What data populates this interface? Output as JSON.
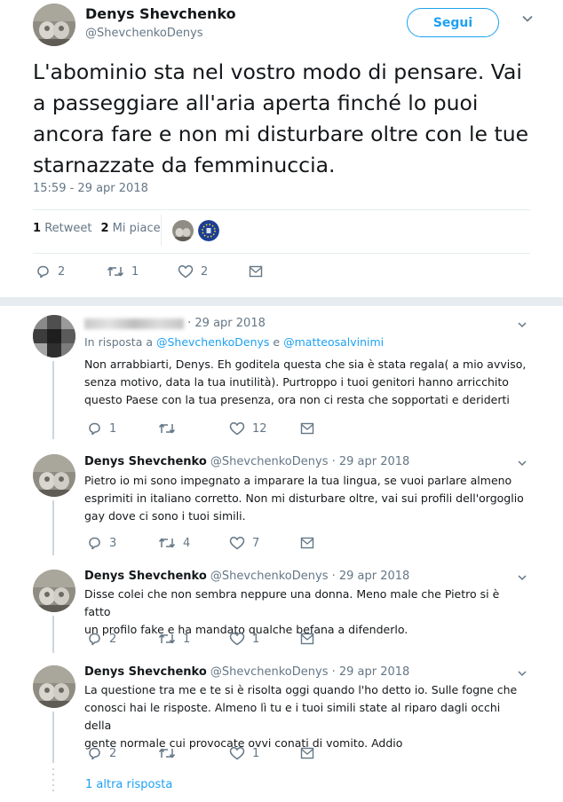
{
  "main_tweet": {
    "author_name": "Denys Shevchenko",
    "author_handle": "@ShevchenkoDenys",
    "follow_label": "Segui",
    "text": "L'abominio sta nel vostro modo di pensare. Vai a passeggiare all'aria aperta finché lo puoi ancora fare e non mi disturbare oltre con le tue starnazzate da femminuccia.",
    "timestamp": "15:59 - 29 apr 2018",
    "retweets_count": "1",
    "retweets_label": "Retweet",
    "likes_count": "2",
    "likes_label": "Mi piace",
    "actions": {
      "replies": "2",
      "retweets": "1",
      "likes": "2"
    }
  },
  "replies": [
    {
      "name": "",
      "meta": "· 29 apr 2018",
      "in_reply_prefix": "In risposta a",
      "in_reply_user1": "@ShevchenkoDenys",
      "in_reply_and": "e",
      "in_reply_user2": "@matteosalvinimi",
      "lines": [
        "Non arrabbiarti, Denys. Eh goditela questa che sia è stata regala( a mio avviso,",
        "senza motivo, data la tua inutilità). Purtroppo i tuoi genitori hanno arricchito",
        "questo Paese con la tua presenza, ora non ci resta che sopportati e deriderti"
      ],
      "actions": {
        "replies": "1",
        "retweets": "",
        "likes": "12"
      }
    },
    {
      "name": "Denys Shevchenko",
      "meta": "@ShevchenkoDenys · 29 apr 2018",
      "lines": [
        "Pietro io mi sono impegnato a imparare la tua lingua, se vuoi parlare almeno",
        "esprimiti in italiano corretto. Non mi disturbare oltre, vai sui profili dell'orgoglio",
        "gay dove ci sono i tuoi simili."
      ],
      "actions": {
        "replies": "3",
        "retweets": "4",
        "likes": "7"
      }
    },
    {
      "name": "Denys Shevchenko",
      "meta": "@ShevchenkoDenys · 29 apr 2018",
      "lines": [
        "Disse colei che non sembra neppure una donna. Meno male che Pietro si è fatto",
        "un profilo fake e ha mandato qualche befana a difenderlo."
      ],
      "actions": {
        "replies": "2",
        "retweets": "1",
        "likes": "1"
      }
    },
    {
      "name": "Denys Shevchenko",
      "meta": "@ShevchenkoDenys · 29 apr 2018",
      "lines": [
        "La questione tra me e te si è risolta oggi quando l'ho detto io. Sulle fogne che",
        "conosci hai le risposte. Almeno lì tu e i tuoi simili state al riparo dagli occhi della",
        "gente normale cui provocate ovvi conati di vomito. Addio"
      ],
      "actions": {
        "replies": "2",
        "retweets": "",
        "likes": "1"
      }
    }
  ],
  "more_replies_label": "1 altra risposta",
  "colors": {
    "accent": "#1da1f2",
    "muted": "#657786",
    "border": "#e6ecf0"
  },
  "icons": [
    "reply-icon",
    "retweet-icon",
    "like-icon",
    "message-icon",
    "chevron-down-icon"
  ]
}
